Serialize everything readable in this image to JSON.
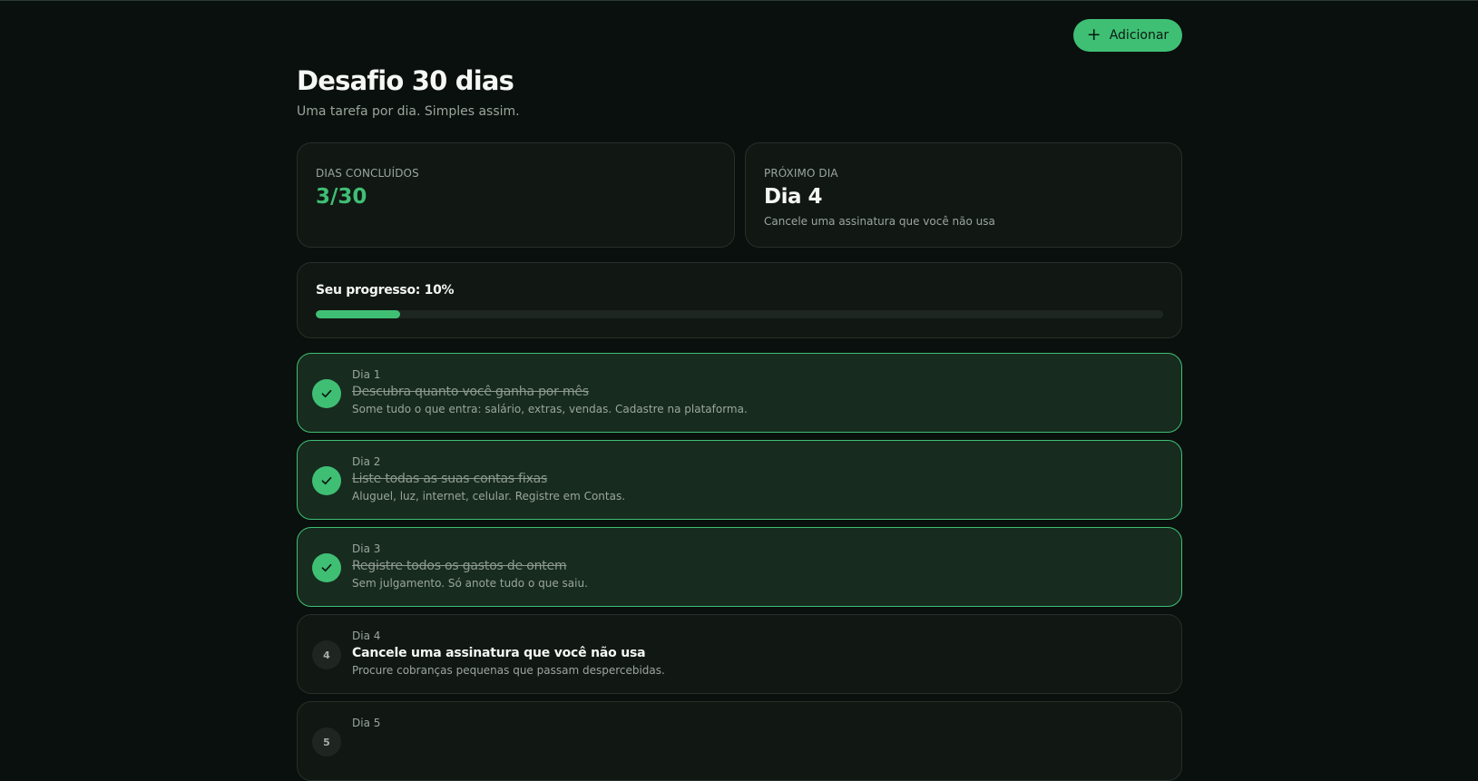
{
  "header": {
    "add_label": "Adicionar",
    "title": "Desafio 30 dias",
    "subtitle": "Uma tarefa por dia. Simples assim."
  },
  "stats": {
    "completed_label": "DIAS CONCLUÍDOS",
    "completed_value": "3/30",
    "next_label": "PRÓXIMO DIA",
    "next_value": "Dia 4",
    "next_desc": "Cancele uma assinatura que você não usa"
  },
  "progress": {
    "label": "Seu progresso: 10%",
    "percent": 10
  },
  "days": [
    {
      "label": "Dia 1",
      "title": "Descubra quanto você ganha por mês",
      "desc": "Some tudo o que entra: salário, extras, vendas. Cadastre na plataforma.",
      "done": true
    },
    {
      "label": "Dia 2",
      "title": "Liste todas as suas contas fixas",
      "desc": "Aluguel, luz, internet, celular. Registre em Contas.",
      "done": true
    },
    {
      "label": "Dia 3",
      "title": "Registre todos os gastos de ontem",
      "desc": "Sem julgamento. Só anote tudo o que saiu.",
      "done": true
    },
    {
      "label": "Dia 4",
      "number": "4",
      "title": "Cancele uma assinatura que você não usa",
      "desc": "Procure cobranças pequenas que passam despercebidas.",
      "done": false
    },
    {
      "label": "Dia 5",
      "number": "5",
      "title": "",
      "desc": "",
      "done": false
    }
  ],
  "colors": {
    "accent": "#3fbf74",
    "background": "#0a100d",
    "card": "#111713",
    "card_done": "#172b1f"
  }
}
